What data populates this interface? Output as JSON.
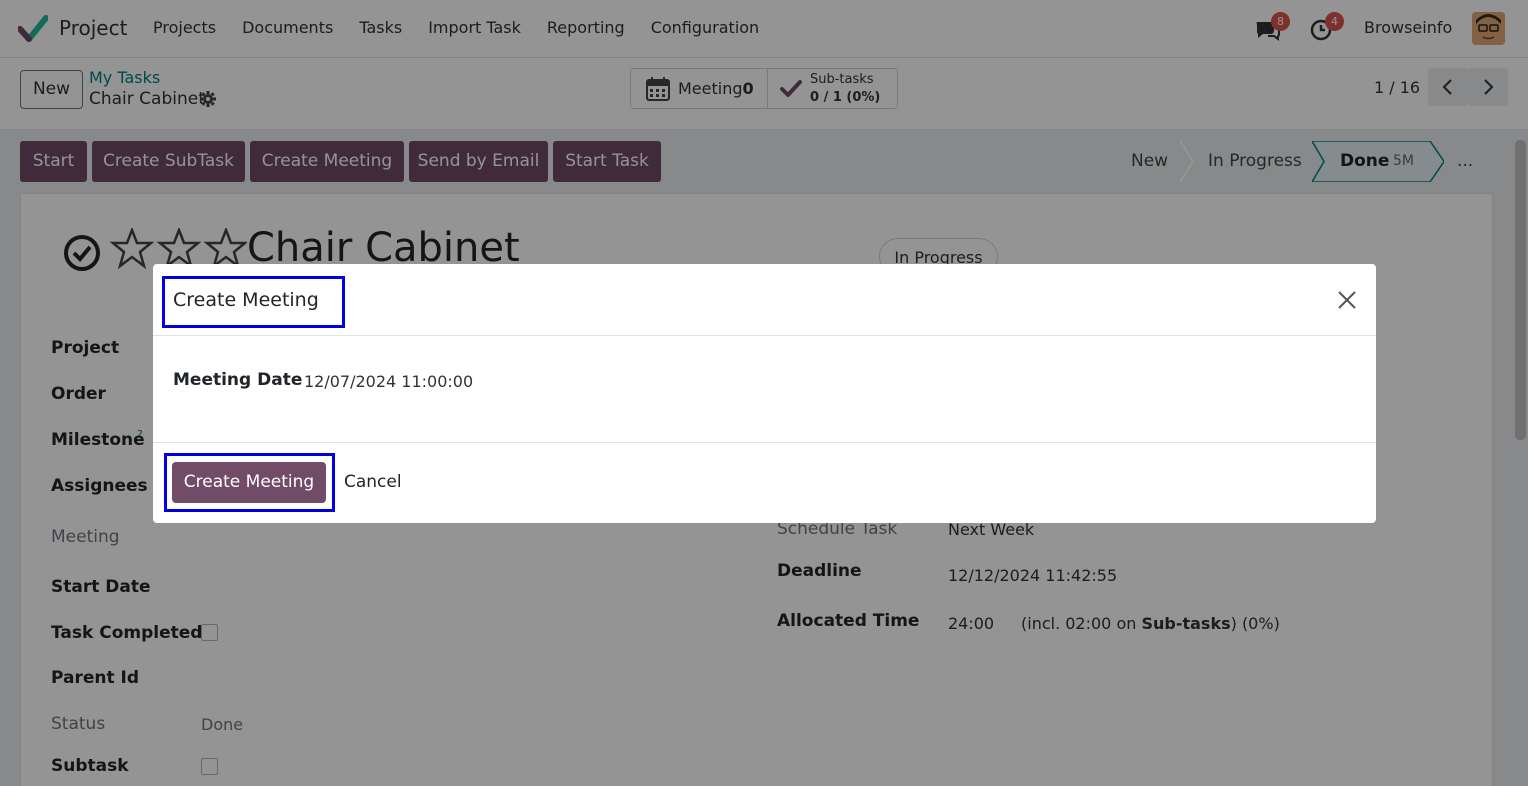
{
  "navbar": {
    "app_name": "Project",
    "menu": [
      "Projects",
      "Documents",
      "Tasks",
      "Import Task",
      "Reporting",
      "Configuration"
    ],
    "messages_badge": "8",
    "activities_badge": "4",
    "user_name": "Browseinfo",
    "icons": [
      "odoo-logo-icon",
      "chat-icon",
      "clock-icon",
      "avatar"
    ]
  },
  "control": {
    "new_label": "New",
    "breadcrumb_parent": "My Tasks",
    "breadcrumb_current": "Chair Cabinet",
    "meeting_label": "Meeting",
    "meeting_count": "0",
    "subtasks_label": "Sub-tasks",
    "subtasks_value": "0 / 1 (0%)",
    "pager": "1 / 16"
  },
  "actions": [
    "Start",
    "Create SubTask",
    "Create Meeting",
    "Send by Email",
    "Start Task"
  ],
  "stages": {
    "new": "New",
    "in_progress": "In Progress",
    "done": "Done",
    "done_time": "5M",
    "more": "..."
  },
  "form": {
    "title": "Chair Cabinet",
    "state_pill": "In Progress",
    "left_labels": {
      "project": "Project",
      "order": "Order",
      "milestone": "Milestone",
      "milestone_help": "?",
      "assignees": "Assignees",
      "meeting": "Meeting",
      "start_date": "Start Date",
      "task_completed": "Task Completed",
      "parent_id": "Parent Id",
      "status": "Status",
      "subtask": "Subtask"
    },
    "status_value": "Done",
    "right": {
      "schedule_task_label": "Schedule Task",
      "schedule_task_value": "Next Week",
      "deadline_label": "Deadline",
      "deadline_value": "12/12/2024 11:42:55",
      "allocated_label": "Allocated Time",
      "allocated_value": "24:00",
      "allocated_incl_prefix": "(incl. 02:00 on",
      "allocated_incl_link": "Sub-tasks",
      "allocated_incl_suffix": ") (0%)"
    }
  },
  "modal": {
    "title": "Create Meeting",
    "meeting_date_label": "Meeting Date",
    "meeting_date_value": "12/07/2024 11:00:00",
    "create_label": "Create Meeting",
    "cancel_label": "Cancel"
  },
  "colors": {
    "primary": "#714b67",
    "link": "#017e84",
    "highlight": "#0000e0",
    "badge": "#d9534f"
  }
}
